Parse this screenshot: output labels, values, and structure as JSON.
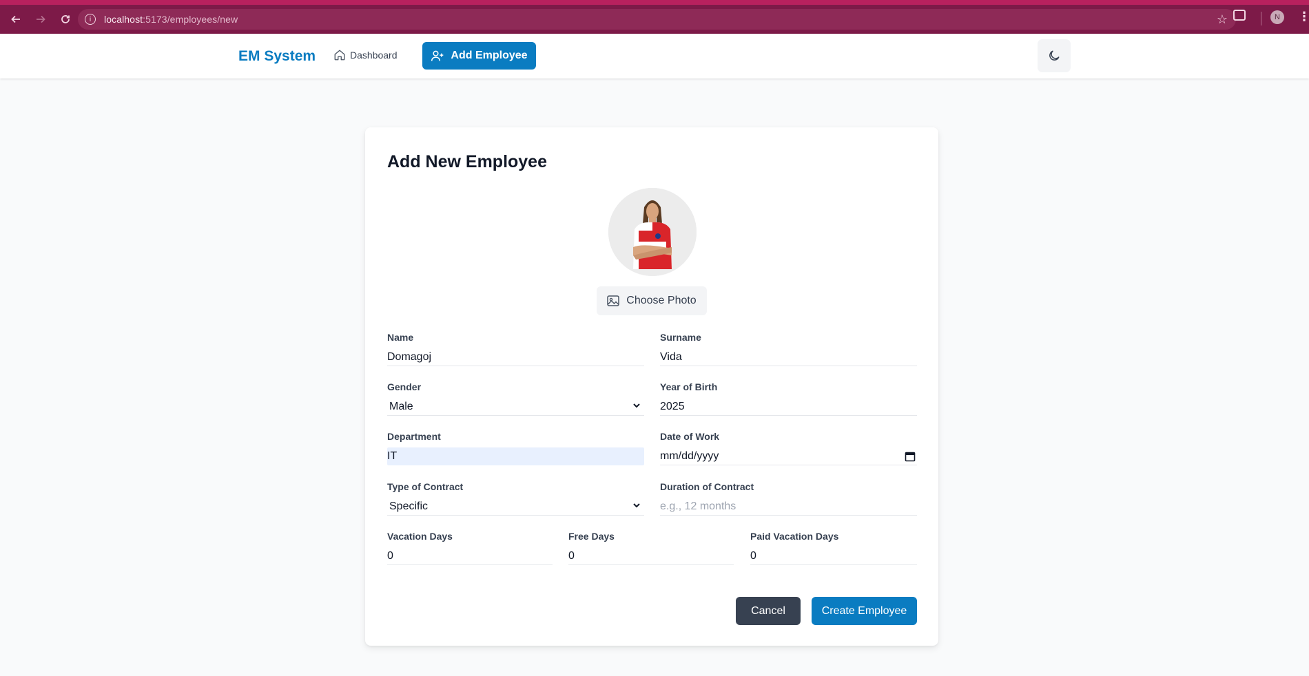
{
  "browser": {
    "url_host": "localhost",
    "url_path": ":5173/employees/new",
    "profile_initial": "N",
    "accent_color": "#7d1a48"
  },
  "navbar": {
    "brand": "EM System",
    "dashboard_label": "Dashboard",
    "add_employee_label": "Add Employee",
    "theme_icon": "moon-icon",
    "brand_color": "#0a7cc1"
  },
  "form": {
    "title": "Add New Employee",
    "choose_photo_label": "Choose Photo",
    "fields": {
      "name": {
        "label": "Name",
        "value": "Domagoj"
      },
      "surname": {
        "label": "Surname",
        "value": "Vida"
      },
      "gender": {
        "label": "Gender",
        "value": "Male"
      },
      "year_of_birth": {
        "label": "Year of Birth",
        "value": "2025"
      },
      "department": {
        "label": "Department",
        "value": "IT"
      },
      "date_of_work": {
        "label": "Date of Work",
        "placeholder": "mm/dd/yyyy"
      },
      "type_of_contract": {
        "label": "Type of Contract",
        "value": "Specific"
      },
      "duration_of_contract": {
        "label": "Duration of Contract",
        "placeholder": "e.g., 12 months"
      },
      "vacation_days": {
        "label": "Vacation Days",
        "value": "0"
      },
      "free_days": {
        "label": "Free Days",
        "value": "0"
      },
      "paid_vacation_days": {
        "label": "Paid Vacation Days",
        "value": "0"
      }
    },
    "cancel_label": "Cancel",
    "create_label": "Create Employee"
  }
}
